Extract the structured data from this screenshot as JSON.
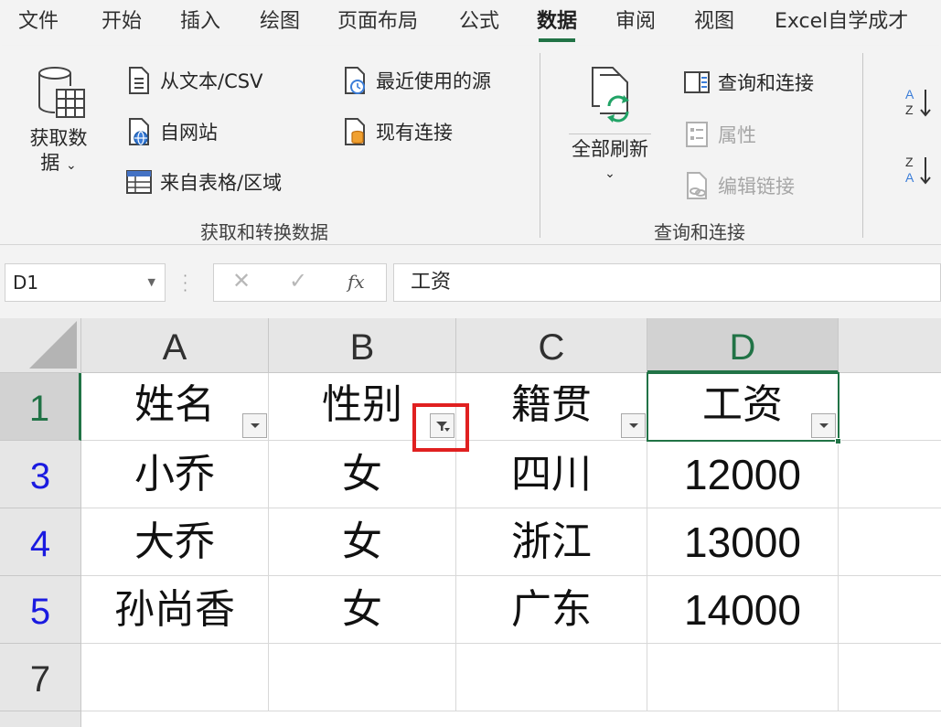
{
  "tabs": [
    "文件",
    "开始",
    "插入",
    "绘图",
    "页面布局",
    "公式",
    "数据",
    "审阅",
    "视图",
    "Excel自学成才"
  ],
  "active_tab": "数据",
  "ribbon": {
    "get_data": {
      "line1": "获取数",
      "line2": "据"
    },
    "from_text_csv": "从文本/CSV",
    "from_web": "自网站",
    "from_table": "来自表格/区域",
    "recent_sources": "最近使用的源",
    "existing_connections": "现有连接",
    "group_get_transform": "获取和转换数据",
    "refresh_all": "全部刷新",
    "queries_connections": "查询和连接",
    "properties": "属性",
    "edit_links": "编辑链接",
    "group_queries": "查询和连接",
    "sort_az_icon": "sort-ascending-icon",
    "sort_za_icon": "sort-descending-icon"
  },
  "formula_bar": {
    "name_box": "D1",
    "fx": "fx",
    "formula": "工资"
  },
  "sheet": {
    "columns": [
      "A",
      "B",
      "C",
      "D"
    ],
    "selected_column": "D",
    "rows": [
      {
        "num": "1",
        "cells": [
          "姓名",
          "性别",
          "籍贯",
          "工资"
        ]
      },
      {
        "num": "3",
        "cells": [
          "小乔",
          "女",
          "四川",
          "12000"
        ]
      },
      {
        "num": "4",
        "cells": [
          "大乔",
          "女",
          "浙江",
          "13000"
        ]
      },
      {
        "num": "5",
        "cells": [
          "孙尚香",
          "女",
          "广东",
          "14000"
        ]
      },
      {
        "num": "7",
        "cells": [
          "",
          "",
          "",
          ""
        ]
      }
    ],
    "active_cell": "D1",
    "filtered_column": "B"
  },
  "colors": {
    "excel_green": "#217346",
    "filtered_row_number": "#1a1ae0",
    "highlight_red": "#e02020"
  }
}
